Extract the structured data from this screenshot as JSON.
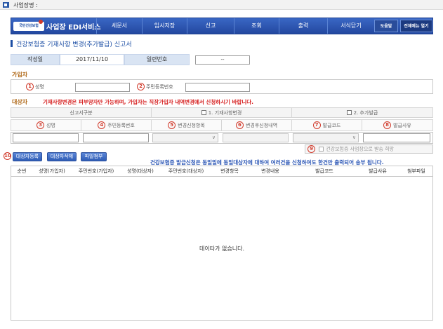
{
  "header": {
    "company_label": "사업장명 :"
  },
  "nav": {
    "logo_text": "국민건강보험",
    "brand": "사업장 EDI서비스",
    "menu": [
      "세문서",
      "임시저장",
      "신고",
      "조회",
      "출력",
      "서식닫기"
    ],
    "help": "도움말",
    "all_menu": "전체메뉴 열기"
  },
  "page": {
    "title": "건강보험증 기재사항 변경(추가발급) 신고서"
  },
  "doc": {
    "date_label": "작성일",
    "date_value": "2017/11/10",
    "serial_label": "일련번호",
    "serial_value": "--"
  },
  "subscriber": {
    "section": "가입자",
    "name_num": "1",
    "name_label": "성명",
    "rrn_num": "2",
    "rrn_label": "주민등록번호"
  },
  "target": {
    "section": "대상자",
    "notice": "기재사항변경은 피부양자만 가능하며, 가입자는 직장가입자 내역변경에서 신청하시기 바랍니다.",
    "report_type_label": "신고서구분",
    "opt1": "1. 기재사항변경",
    "opt2": "2. 추가발급",
    "fields": [
      {
        "num": "3",
        "label": "성명"
      },
      {
        "num": "4",
        "label": "주민등록번호"
      },
      {
        "num": "5",
        "label": "변경신청항목"
      },
      {
        "num": "6",
        "label": "변경후신청내역"
      },
      {
        "num": "7",
        "label": "발급코드"
      },
      {
        "num": "8",
        "label": "발급사유"
      }
    ],
    "hope_num": "9",
    "hope_label": "건강보험증 사업장으로 발송 희망"
  },
  "actions": {
    "num": "10",
    "register": "대상자등록",
    "delete": "대상자삭제",
    "attach": "파일첨부",
    "notice": "건강보험증 발급신청은 동일일에 동일대상자에 대하여 여러건을 신청하여도 한건만 출력되어 송부 됩니다."
  },
  "table": {
    "columns": [
      "순번",
      "성명(가입자)",
      "주민번호(가입자)",
      "성명(대상자)",
      "주민번호(대상자)",
      "변경항목",
      "변경내용",
      "발급코드",
      "발급사유",
      "첨부파일"
    ],
    "empty": "데이타가 없습니다."
  }
}
